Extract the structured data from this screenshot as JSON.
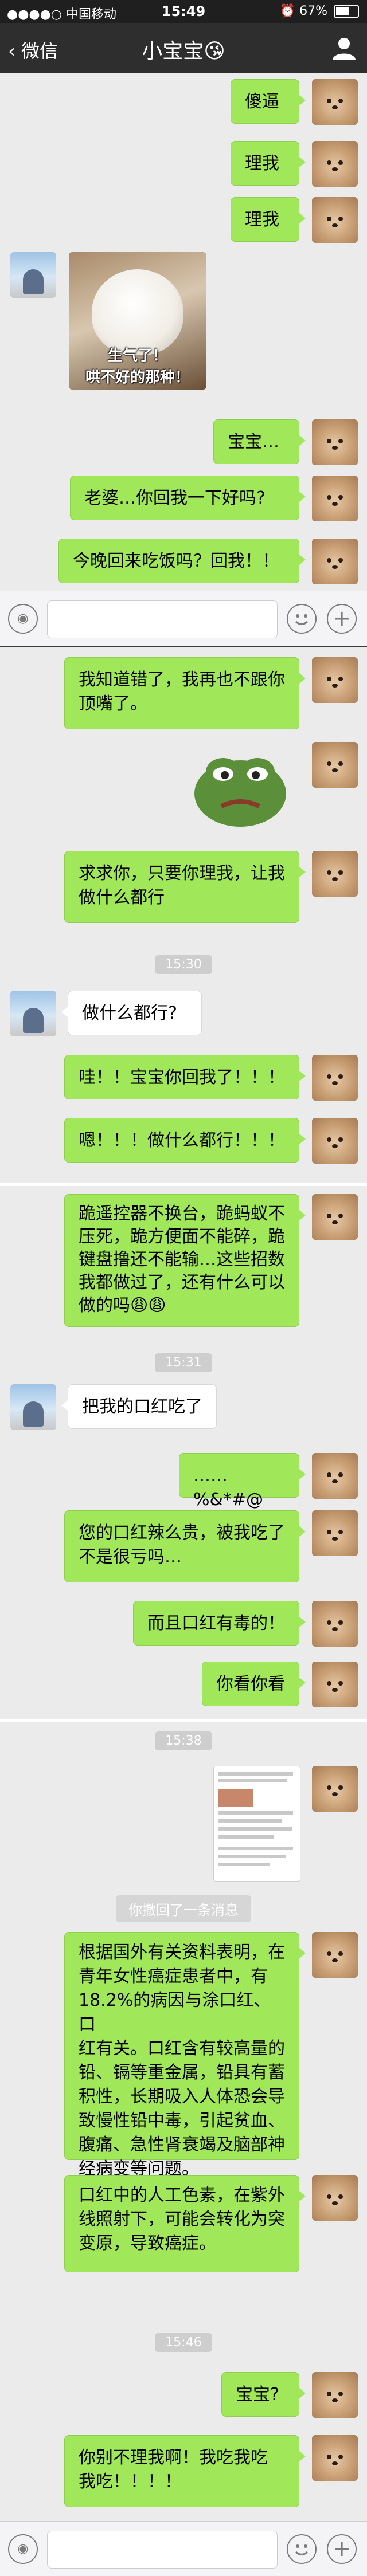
{
  "status_bar": {
    "carrier": "●●●●○ 中国移动",
    "wifi_icon": "wifi-icon",
    "time": "15:49",
    "alarm_icon": "alarm-icon",
    "battery_percent": "67%",
    "battery_level": 0.67
  },
  "nav": {
    "back_label": "微信",
    "title": "小宝宝😘"
  },
  "panel1": {
    "messages": [
      "傻逼",
      "理我",
      "理我",
      "宝宝…",
      "老婆…你回我一下好吗?",
      "今晚回来吃饭吗？回我！！"
    ],
    "sticker_caption": [
      "生气了！",
      "哄不好的那种！"
    ]
  },
  "panel2": {
    "msg_knew": [
      "我知道错了，我再也不跟你",
      "顶嘴了。"
    ],
    "msg_beg": [
      "求求你，只要你理我，让我",
      "做什么都行"
    ],
    "time_1": "15:30",
    "msg_anything_q": "做什么都行?",
    "msg_wa": "哇！！宝宝你回我了！！！",
    "msg_en": "嗯！！！做什么都行！！！"
  },
  "panel3": {
    "msg_kneel": [
      "跪遥控器不换台，跪蚂蚁不",
      "压死，跪方便面不能碎，跪",
      "键盘撸还不能输…这些招数",
      "我都做过了，还有什么可以",
      "做的吗😩😩"
    ]
  },
  "panel4": {
    "time_2": "15:31",
    "msg_eat_lipstick": "把我的口红吃了",
    "msg_symbols": "……%&*#@",
    "msg_expensive": [
      "您的口红辣么贵，被我吃了",
      "不是很亏吗…"
    ],
    "msg_toxic": "而且口红有毒的！",
    "msg_look": "你看你看"
  },
  "panel5": {
    "time_3": "15:38",
    "recall_notice": "你撤回了一条消息",
    "msg_research": [
      "根据国外有关资料表明，在",
      "青年女性癌症患者中，有",
      "18.2%的病因与涂口红、口",
      "红有关。口红含有较高量的",
      "铅、镉等重金属，铅具有蓄",
      "积性，长期吸入人体恐会导",
      "致慢性铅中毒，引起贫血、",
      "腹痛、急性肾衰竭及脑部神",
      "经病变等问题。"
    ],
    "msg_pigment": [
      "口红中的人工色素，在紫外",
      "线照射下，可能会转化为突",
      "变原，导致癌症。"
    ],
    "time_4": "15:46",
    "msg_baby": "宝宝?",
    "msg_dont_ignore": [
      "你别不理我啊！我吃我吃",
      "我吃！！！！"
    ]
  },
  "colors": {
    "chat_bg": "#ebebeb",
    "outgoing_bubble": "#a0e75a",
    "incoming_bubble": "#ffffff",
    "nav_bg": "#2e2e2e",
    "status_bg": "#1f1f1f"
  }
}
